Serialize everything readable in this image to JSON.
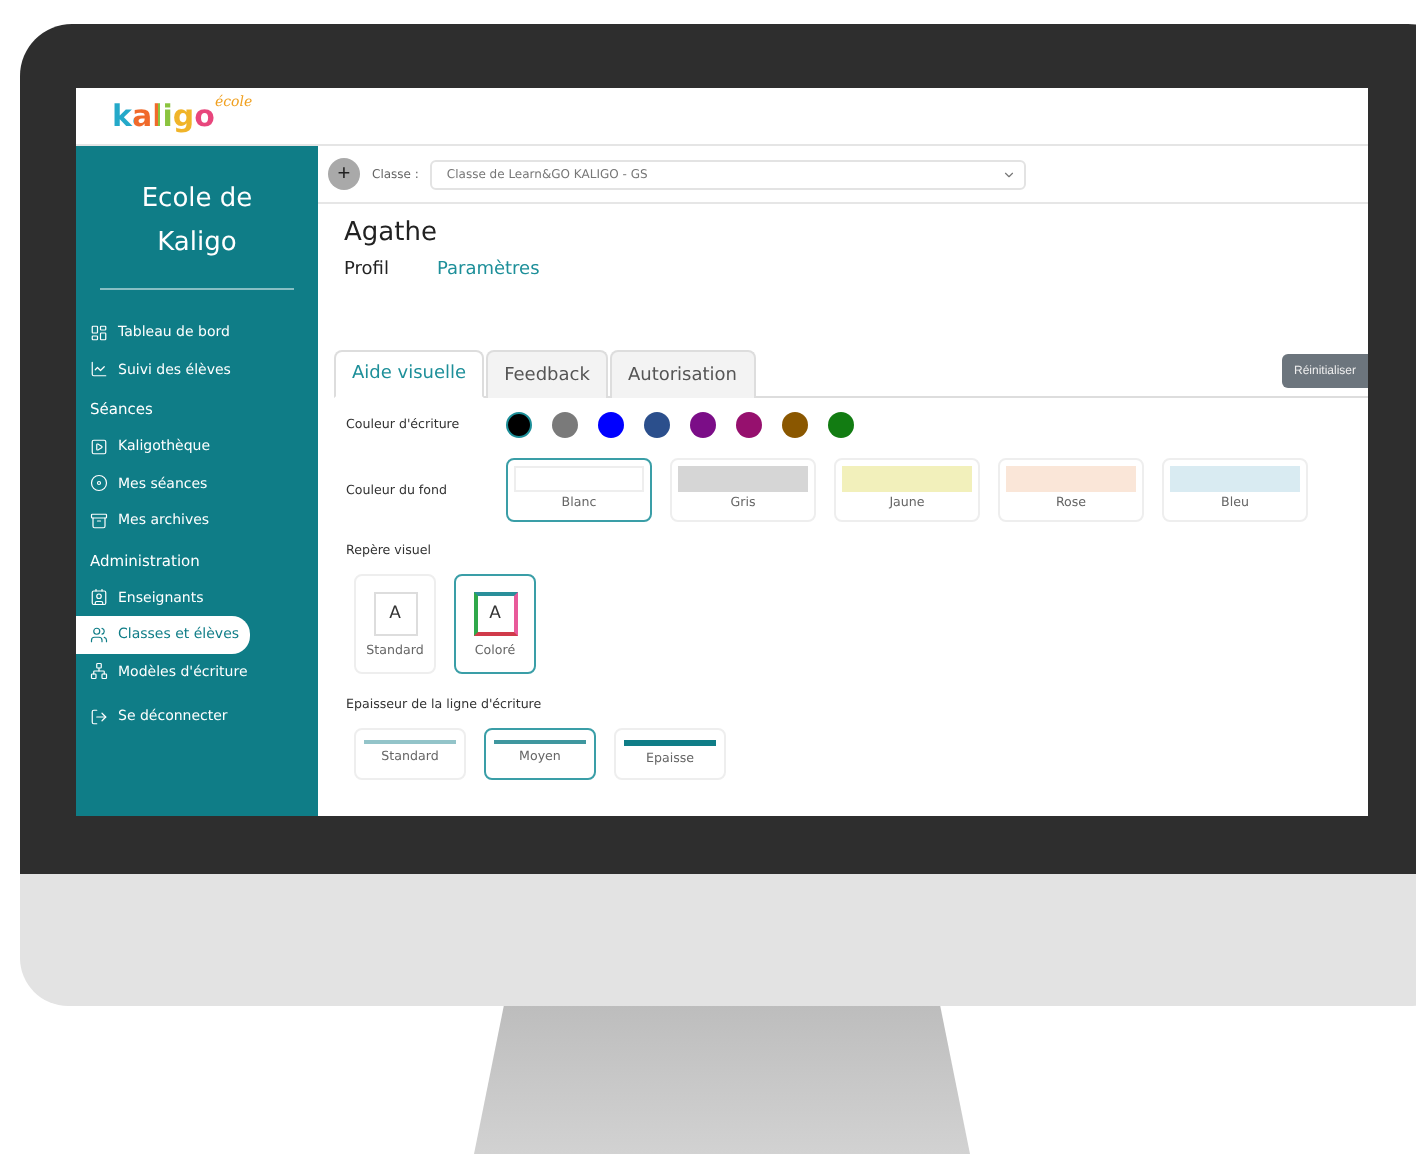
{
  "logo": {
    "name": "kaligo",
    "tag": "école"
  },
  "sidebar": {
    "title": "Ecole de Kaligo",
    "items": [
      {
        "kind": "link",
        "label": "Tableau de bord",
        "selected": false
      },
      {
        "kind": "link",
        "label": "Suivi des élèves",
        "selected": false
      },
      {
        "kind": "section",
        "label": "Séances"
      },
      {
        "kind": "link",
        "label": "Kaligothèque",
        "selected": false
      },
      {
        "kind": "link",
        "label": "Mes séances",
        "selected": false
      },
      {
        "kind": "link",
        "label": "Mes archives",
        "selected": false
      },
      {
        "kind": "section",
        "label": "Administration"
      },
      {
        "kind": "link",
        "label": "Enseignants",
        "selected": false
      },
      {
        "kind": "link",
        "label": "Classes et élèves",
        "selected": true
      },
      {
        "kind": "link",
        "label": "Modèles d'écriture",
        "selected": false
      },
      {
        "kind": "logout",
        "label": "Se déconnecter",
        "selected": false
      }
    ]
  },
  "class_bar": {
    "add": "+",
    "label": "Classe :",
    "value": "Classe de Learn&GO KALIGO - GS"
  },
  "student": {
    "name": "Agathe",
    "tabs": [
      {
        "label": "Profil",
        "selected": false
      },
      {
        "label": "Paramètres",
        "selected": true
      }
    ]
  },
  "settings_tabs": [
    {
      "label": "Aide visuelle",
      "selected": true
    },
    {
      "label": "Feedback",
      "selected": false
    },
    {
      "label": "Autorisation",
      "selected": false
    }
  ],
  "reset_button": "Réinitialiser",
  "writing_color": {
    "label": "Couleur d'écriture",
    "swatches": [
      {
        "color": "#000000",
        "selected": true
      },
      {
        "color": "#7a7a7a",
        "selected": false
      },
      {
        "color": "#0000ff",
        "selected": false
      },
      {
        "color": "#2b4f8c",
        "selected": false
      },
      {
        "color": "#7b0d87",
        "selected": false
      },
      {
        "color": "#96106e",
        "selected": false
      },
      {
        "color": "#8a5700",
        "selected": false
      },
      {
        "color": "#127c12",
        "selected": false
      }
    ]
  },
  "background_color": {
    "label": "Couleur du fond",
    "options": [
      {
        "label": "Blanc",
        "color": "#ffffff",
        "selected": true
      },
      {
        "label": "Gris",
        "color": "#d6d6d6",
        "selected": false
      },
      {
        "label": "Jaune",
        "color": "#f2f0bb",
        "selected": false
      },
      {
        "label": "Rose",
        "color": "#fae6d8",
        "selected": false
      },
      {
        "label": "Bleu",
        "color": "#d9ebf2",
        "selected": false
      }
    ]
  },
  "visual_marker": {
    "label": "Repère visuel",
    "options": [
      {
        "kind": "standard",
        "letter": "A",
        "label": "Standard",
        "selected": false
      },
      {
        "kind": "colored",
        "letter": "A",
        "label": "Coloré",
        "selected": true
      }
    ]
  },
  "line_thickness": {
    "label": "Epaisseur de la ligne d'écriture",
    "options": [
      {
        "kind": "thin",
        "label": "Standard",
        "selected": false
      },
      {
        "kind": "medium",
        "label": "Moyen",
        "selected": true
      },
      {
        "kind": "thick",
        "label": "Epaisse",
        "selected": false
      }
    ]
  }
}
